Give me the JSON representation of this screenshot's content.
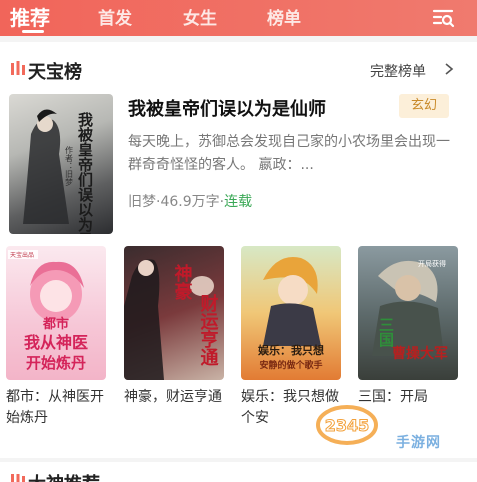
{
  "nav": {
    "tabs": [
      "推荐",
      "首发",
      "女生",
      "榜单"
    ],
    "active": 0,
    "search_icon": "search-list-icon"
  },
  "section": {
    "title": "天宝榜",
    "more": "完整榜单",
    "icon": "rank-bars-icon",
    "chevron_icon": "chevron-right-icon"
  },
  "featured": {
    "title": "我被皇帝们误以为是仙师",
    "tag": "玄幻",
    "description": "每天晚上，苏御总会发现自己家的小农场里会出现一群奇奇怪怪的客人。 嬴政：...",
    "author": "旧梦",
    "separator": "·",
    "words": "46.9万字",
    "status": "连载",
    "cover_text": "我被皇帝们误以为是仙师",
    "cover_author": "作者：旧梦"
  },
  "books": [
    {
      "title": "都市：从神医开始炼丹",
      "cover_text_1": "都市",
      "cover_text_2": "我从神医",
      "cover_text_3": "开始炼丹",
      "cover_badge": "天宝出品"
    },
    {
      "title": "神豪，财运亨通",
      "cover_text_1": "神豪",
      "cover_text_2": "财运亨通"
    },
    {
      "title": "娱乐：我只想做个安",
      "cover_text_1": "娱乐：我只想",
      "cover_text_2": "安静的做个歌手"
    },
    {
      "title": "三国：开局",
      "cover_text_1": "三国",
      "cover_text_2": "曹操大军",
      "cover_text_3": "开局获得"
    }
  ],
  "watermark": {
    "logo": "2345",
    "text": "手游网"
  },
  "next_section": {
    "title": "大神推荐"
  },
  "colors": {
    "header": "#f1655a",
    "accent": "#f26a5b",
    "tag_bg": "#fcefd9",
    "tag_text": "#c98a2a",
    "status": "#3aa856"
  }
}
